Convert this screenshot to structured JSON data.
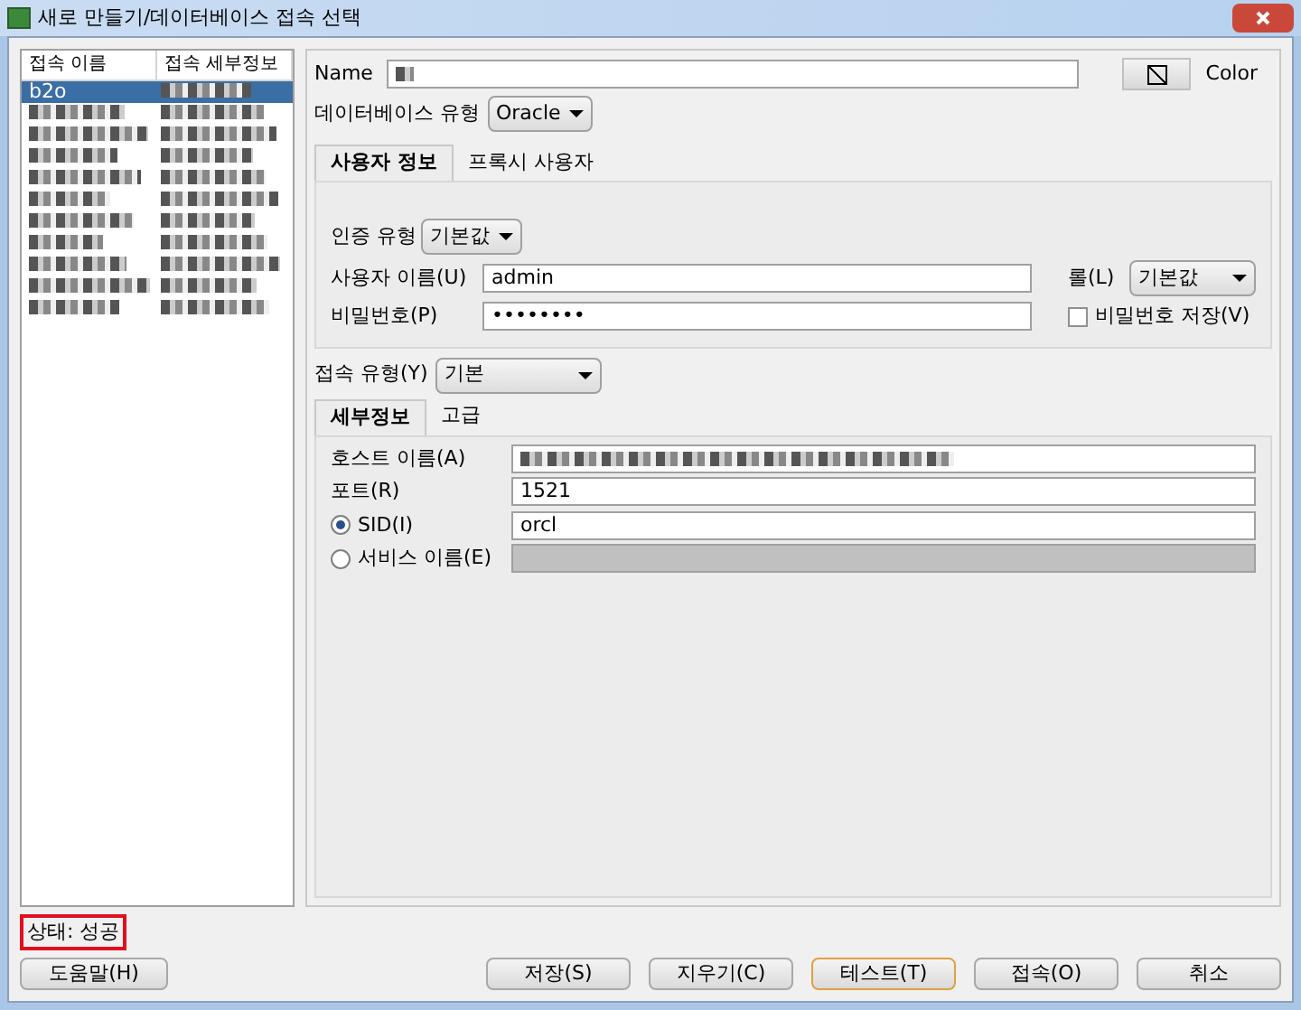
{
  "window": {
    "title": "새로 만들기/데이터베이스 접속 선택"
  },
  "connections": {
    "columns": [
      "접속 이름",
      "접속 세부정보"
    ],
    "rows": [
      {
        "name": "b2o",
        "selected": true
      },
      {
        "selected": false
      },
      {
        "selected": false
      },
      {
        "selected": false
      },
      {
        "selected": false
      },
      {
        "selected": false
      },
      {
        "selected": false
      },
      {
        "selected": false
      },
      {
        "selected": false
      },
      {
        "selected": false
      },
      {
        "selected": false
      }
    ]
  },
  "name_label": "Name",
  "color_label": "Color",
  "db_type": {
    "label": "데이터베이스 유형",
    "value": "Oracle"
  },
  "user_tabs": [
    {
      "label": "사용자 정보",
      "selected": true
    },
    {
      "label": "프록시 사용자",
      "selected": false
    }
  ],
  "auth_type": {
    "label": "인증 유형",
    "value": "기본값"
  },
  "username": {
    "label": "사용자 이름(U)",
    "value": "admin"
  },
  "role": {
    "label": "롤(L)",
    "value": "기본값"
  },
  "password": {
    "label": "비밀번호(P)",
    "value": "••••••••"
  },
  "save_password": {
    "label": "비밀번호 저장(V)",
    "checked": false
  },
  "conn_type": {
    "label": "접속 유형(Y)",
    "value": "기본"
  },
  "detail_tabs": [
    {
      "label": "세부정보",
      "selected": true
    },
    {
      "label": "고급",
      "selected": false
    }
  ],
  "host": {
    "label": "호스트 이름(A)"
  },
  "port": {
    "label": "포트(R)",
    "value": "1521"
  },
  "sid_options": [
    {
      "label": "SID(I)",
      "selected": true,
      "value": "orcl"
    },
    {
      "label": "서비스 이름(E)",
      "selected": false
    }
  ],
  "status": "상태: 성공",
  "help_button": "도움말(H)",
  "buttons": [
    {
      "label": "저장(S)",
      "focused": false
    },
    {
      "label": "지우기(C)",
      "focused": false
    },
    {
      "label": "테스트(T)",
      "focused": true
    },
    {
      "label": "접속(O)",
      "focused": false
    },
    {
      "label": "취소",
      "focused": false
    }
  ]
}
